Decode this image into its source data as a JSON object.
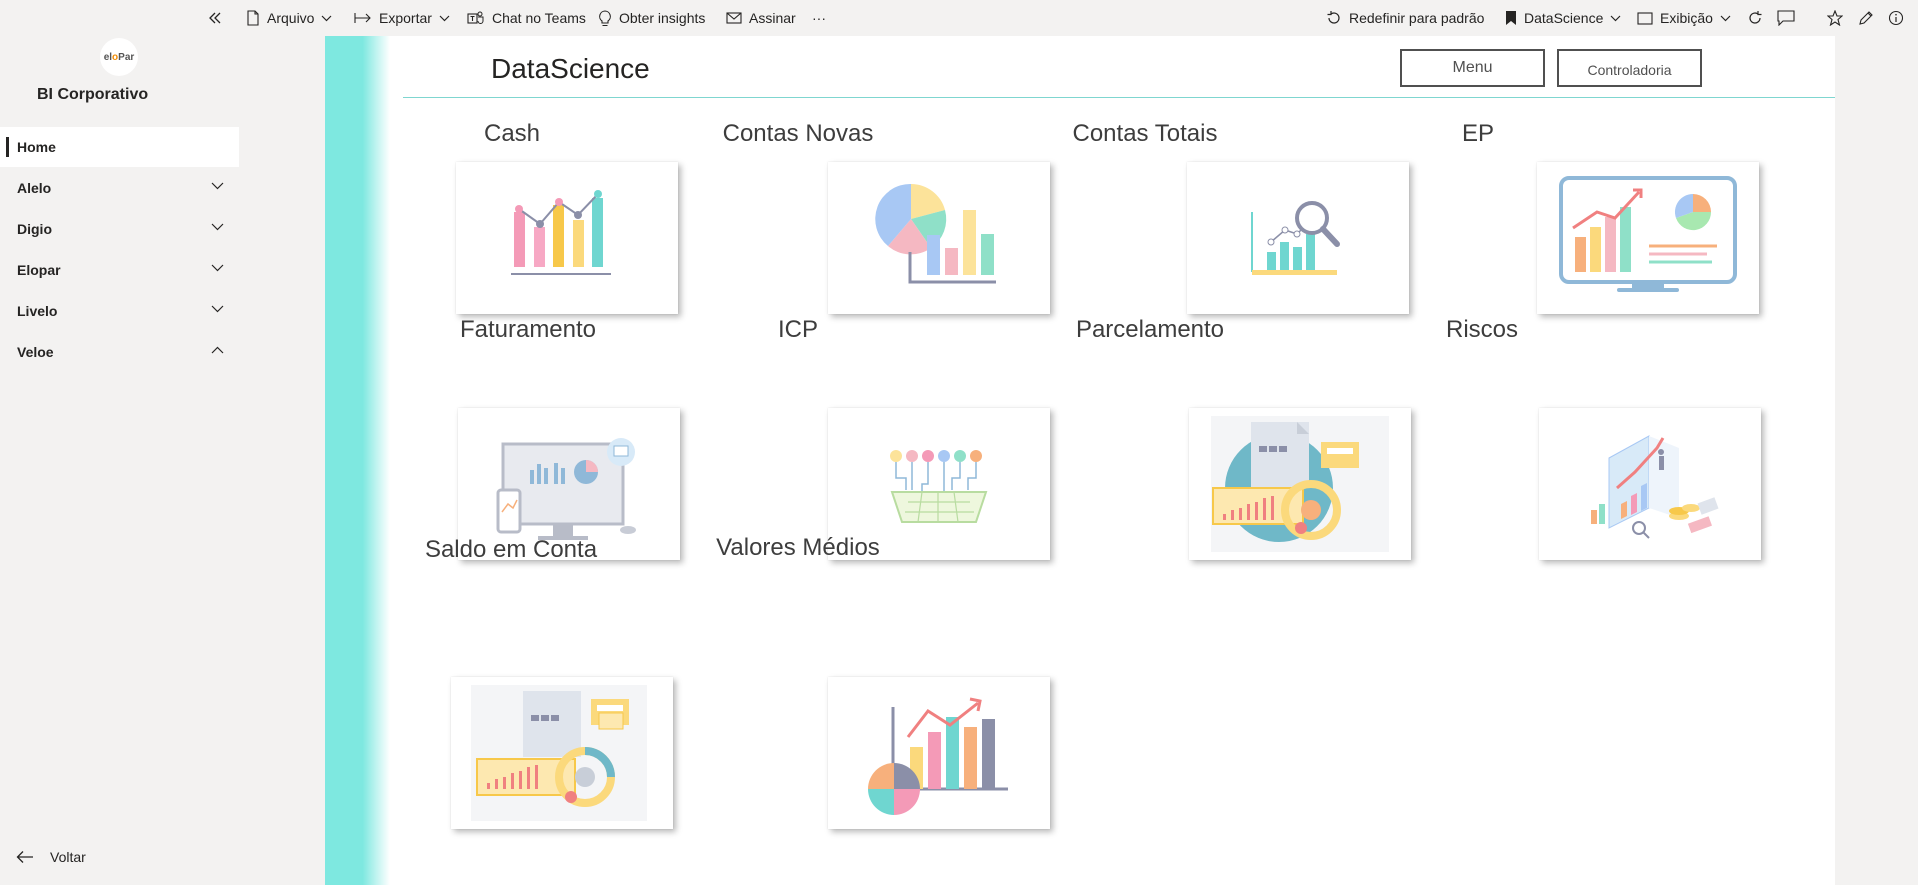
{
  "toolbar": {
    "collapse_icon": "double-chevron-left-icon",
    "file_label": "Arquivo",
    "export_label": "Exportar",
    "teams_label": "Chat no Teams",
    "insights_label": "Obter insights",
    "subscribe_label": "Assinar",
    "more_label": "···",
    "reset_label": "Redefinir para padrão",
    "bookmark_label": "DataScience",
    "view_label": "Exibição"
  },
  "sidebar": {
    "logo_text_a": "el",
    "logo_text_o": "o",
    "logo_text_b": "Par",
    "workspace_title": "BI Corporativo",
    "items": [
      {
        "label": "Home",
        "active": true
      },
      {
        "label": "Alelo",
        "expanded": false
      },
      {
        "label": "Digio",
        "expanded": false
      },
      {
        "label": "Elopar",
        "expanded": false
      },
      {
        "label": "Livelo",
        "expanded": false
      },
      {
        "label": "Veloe",
        "expanded": true
      }
    ],
    "back_label": "Voltar"
  },
  "report": {
    "title": "DataScience",
    "menu_button": "Menu",
    "controladoria_button": "Controladoria",
    "tiles": [
      {
        "title": "Cash",
        "icon": "bar-line-chart-icon"
      },
      {
        "title": "Contas Novas",
        "icon": "pie-bar-chart-icon"
      },
      {
        "title": "Contas Totais",
        "icon": "magnifier-chart-icon"
      },
      {
        "title": "EP",
        "icon": "monitor-dashboard-icon"
      },
      {
        "title": "Faturamento",
        "icon": "desktop-analytics-icon"
      },
      {
        "title": "ICP",
        "icon": "network-grid-icon"
      },
      {
        "title": "Parcelamento",
        "icon": "document-gears-icon"
      },
      {
        "title": "Riscos",
        "icon": "isometric-finance-icon"
      },
      {
        "title": "Saldo em Conta",
        "icon": "document-gears-icon"
      },
      {
        "title": "Valores Médios",
        "icon": "growth-chart-pie-icon"
      }
    ]
  },
  "colors": {
    "accent_teal": "#7ee8e0",
    "sidebar_bg": "#f3f2f1",
    "canvas_bg": "#ffffff"
  }
}
